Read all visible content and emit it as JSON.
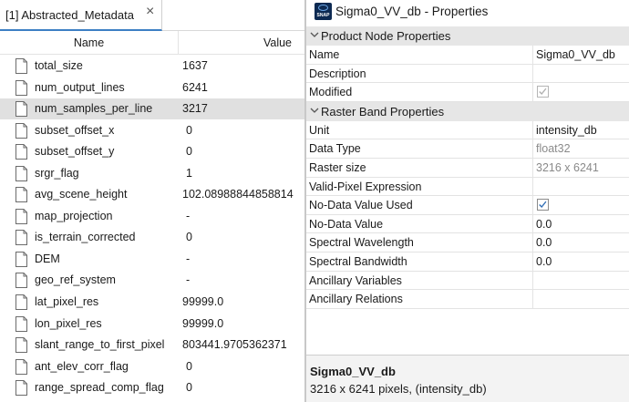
{
  "metadata_panel": {
    "tab_label": "[1] Abstracted_Metadata",
    "tab_close": "×",
    "column_name": "Name",
    "column_value": "Value",
    "rows": [
      {
        "name": "total_size",
        "value": "1637"
      },
      {
        "name": "num_output_lines",
        "value": "6241"
      },
      {
        "name": "num_samples_per_line",
        "value": "3217"
      },
      {
        "name": "subset_offset_x",
        "value": "0"
      },
      {
        "name": "subset_offset_y",
        "value": "0"
      },
      {
        "name": "srgr_flag",
        "value": "1"
      },
      {
        "name": "avg_scene_height",
        "value": "102.08988844858814"
      },
      {
        "name": "map_projection",
        "value": "-"
      },
      {
        "name": "is_terrain_corrected",
        "value": "0"
      },
      {
        "name": "DEM",
        "value": "-"
      },
      {
        "name": "geo_ref_system",
        "value": "-"
      },
      {
        "name": "lat_pixel_res",
        "value": "99999.0"
      },
      {
        "name": "lon_pixel_res",
        "value": "99999.0"
      },
      {
        "name": "slant_range_to_first_pixel",
        "value": "803441.9705362371"
      },
      {
        "name": "ant_elev_corr_flag",
        "value": "0"
      },
      {
        "name": "range_spread_comp_flag",
        "value": "0"
      }
    ],
    "selected_row": "num_samples_per_line"
  },
  "properties_window": {
    "logo_text": "SNAP",
    "title": "Sigma0_VV_db - Properties",
    "section_product": "Product Node Properties",
    "section_raster": "Raster Band Properties",
    "product_props": [
      {
        "name": "Name",
        "value": "Sigma0_VV_db",
        "kind": "text"
      },
      {
        "name": "Description",
        "value": "",
        "kind": "text"
      },
      {
        "name": "Modified",
        "value": "checked",
        "kind": "check-disabled"
      }
    ],
    "raster_props": [
      {
        "name": "Unit",
        "value": "intensity_db",
        "kind": "text"
      },
      {
        "name": "Data Type",
        "value": "float32",
        "kind": "gray"
      },
      {
        "name": "Raster size",
        "value": "3216 x 6241",
        "kind": "gray"
      },
      {
        "name": "Valid-Pixel Expression",
        "value": "",
        "kind": "text"
      },
      {
        "name": "No-Data Value Used",
        "value": "checked",
        "kind": "check-enabled"
      },
      {
        "name": "No-Data Value",
        "value": "0.0",
        "kind": "text"
      },
      {
        "name": "Spectral Wavelength",
        "value": "0.0",
        "kind": "text"
      },
      {
        "name": "Spectral Bandwidth",
        "value": "0.0",
        "kind": "text"
      },
      {
        "name": "Ancillary Variables",
        "value": "",
        "kind": "text"
      },
      {
        "name": "Ancillary Relations",
        "value": "",
        "kind": "text"
      }
    ],
    "description_title": "Sigma0_VV_db",
    "description_text": "3216 x 6241 pixels, (intensity_db)"
  },
  "colors": {
    "selection": "#e0e0e0",
    "section_header": "#e6e6e6",
    "tab_accent": "#3c7fc4",
    "checkmark_enabled": "#2f6db5",
    "checkmark_disabled": "#b0b0b0",
    "logo_bg": "#0d2a52"
  },
  "icons": {
    "row_icon": "file-icon",
    "section_toggle": "chevron-down-icon",
    "window_icon": "snap-logo-icon"
  }
}
